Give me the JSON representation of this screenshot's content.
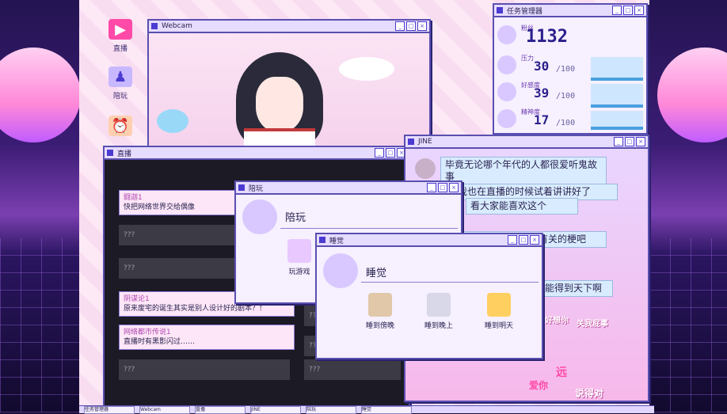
{
  "desktop_icons": [
    {
      "label": "直播",
      "icon": "stream-icon"
    },
    {
      "label": "陪玩",
      "icon": "game-icon"
    },
    {
      "label": "",
      "icon": "alarm-clock-icon"
    }
  ],
  "webcam": {
    "title": "Webcam"
  },
  "stream": {
    "title": "直播",
    "comments": [
      {
        "user": "闘迦1",
        "text": "快把网络世界交给偶像"
      },
      {
        "user": "",
        "text": "???"
      },
      {
        "user": "",
        "text": "???"
      },
      {
        "user": "阴谋论1",
        "text": "原来废宅的诞生其实是别人设计好的剧本？！"
      },
      {
        "user": "网络都市传说1",
        "text": "直播时有黑影闪过……"
      },
      {
        "user": "",
        "text": "???"
      }
    ],
    "right_empty": [
      "???",
      "???",
      "???"
    ]
  },
  "task_manager": {
    "title": "任务管理器",
    "stats": [
      {
        "label": "粉丝",
        "value": "1132",
        "max": ""
      },
      {
        "label": "压力",
        "value": "30",
        "max": "100"
      },
      {
        "label": "好感度",
        "value": "39",
        "max": "100"
      },
      {
        "label": "精神度",
        "value": "17",
        "max": "100"
      }
    ]
  },
  "jine": {
    "title": "JINE",
    "messages": [
      "毕竟无论哪个年代的人都很爱听鬼故事",
      "我也在直播的时候试着讲讲好了",
      "看大家能喜欢这个",
      "次就先讲个跟主播有关的梗吧",
      "能得到天下啊"
    ],
    "stickers": [
      "好想你",
      "关我屁事",
      "说得对",
      "爱你",
      "远"
    ]
  },
  "play_window": {
    "title": "陪玩",
    "heading": "陪玩",
    "action": "玩游戏"
  },
  "sleep_window": {
    "title": "睡觉",
    "heading": "睡觉",
    "actions": [
      "睡到傍晚",
      "睡到晚上",
      "睡到明天"
    ]
  },
  "taskbar": {
    "items": [
      "任务管理器",
      "Webcam",
      "直播",
      "JINE",
      "陪玩",
      "睡觉"
    ]
  },
  "colors": {
    "accent": "#5a4fb0",
    "bar": "#4aa0e0",
    "pink": "#f7b8ea"
  }
}
